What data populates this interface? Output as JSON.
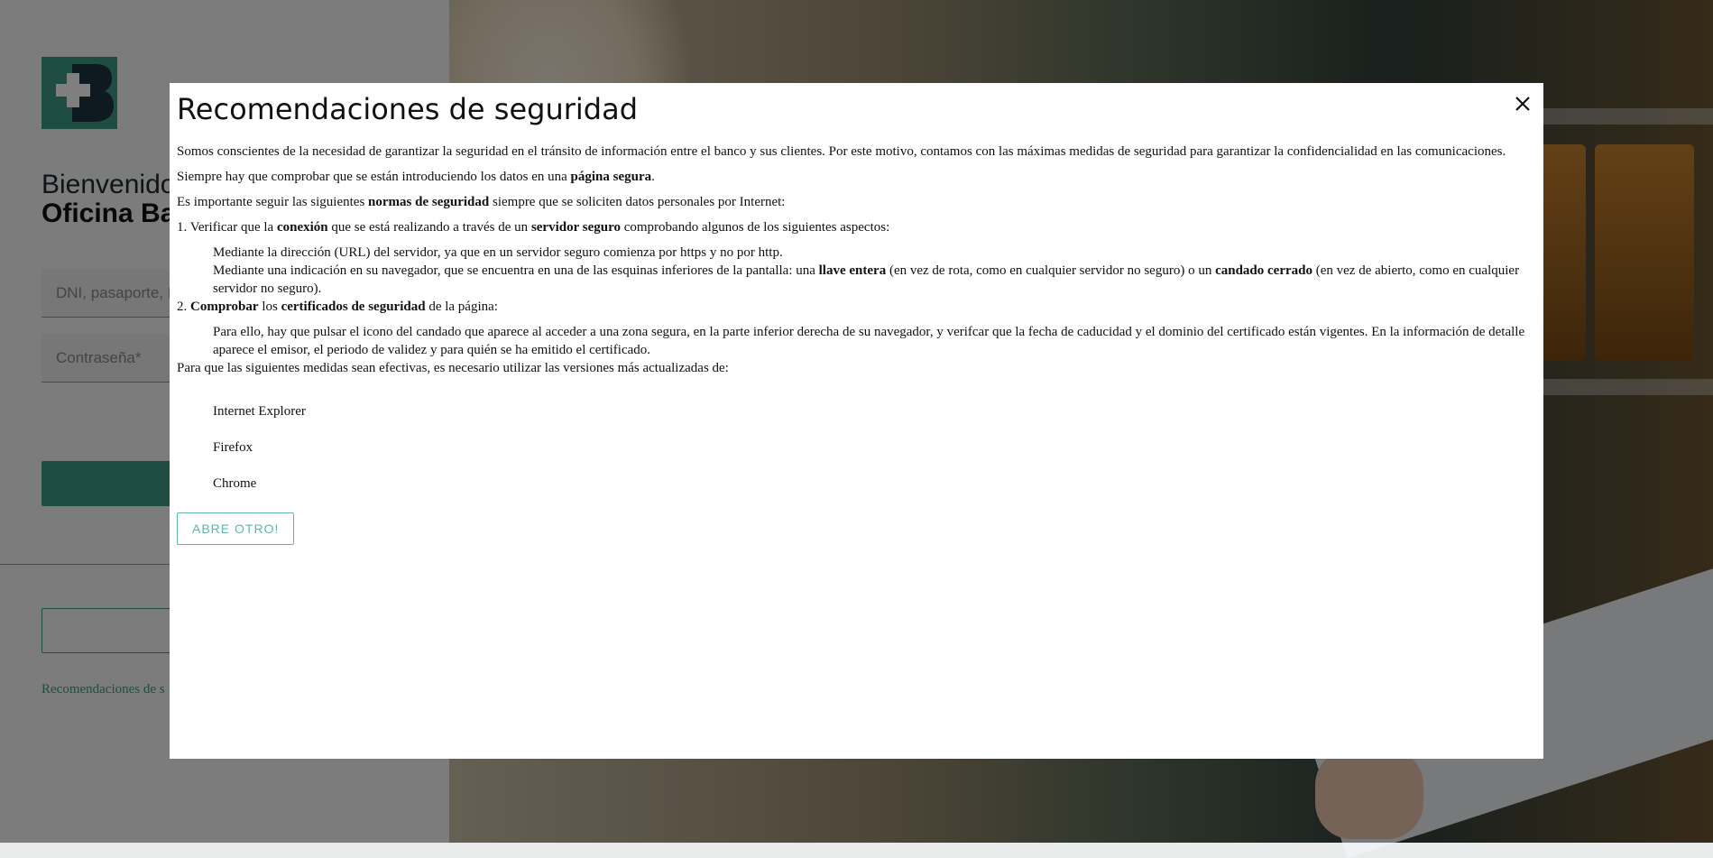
{
  "login": {
    "welcome": "Bienvenido",
    "welcome_strong": "Oficina Ba",
    "id_placeholder": "DNI, pasaporte, N",
    "password_placeholder": "Contraseña*",
    "recommendations_link": "Recomendaciones de s"
  },
  "modal": {
    "title": "Recomendaciones de seguridad",
    "p1": "Somos conscientes de la necesidad de garantizar la seguridad en el tránsito de información entre el banco y sus clientes. Por este motivo, contamos con las máximas medidas de seguridad para garantizar la confidencialidad en las comunicaciones.",
    "p2_a": "Siempre hay que comprobar que se están introduciendo los datos en una ",
    "p2_b": "página segura",
    "p2_c": ".",
    "p3_a": "Es importante seguir las siguientes ",
    "p3_b": "normas de seguridad",
    "p3_c": " siempre que se soliciten datos personales por Internet:",
    "item1_a": "1. Verificar que la ",
    "item1_b": "conexión",
    "item1_c": " que se está realizando a través de un ",
    "item1_d": "servidor seguro",
    "item1_e": " comprobando algunos de los siguientes aspectos:",
    "item1_sub1": "Mediante la dirección (URL) del servidor, ya que en un servidor seguro comienza por https y no por http.",
    "item1_sub2_a": "Mediante una indicación en su navegador, que se encuentra en una de las esquinas inferiores de la pantalla: una ",
    "item1_sub2_b": "llave entera",
    "item1_sub2_c": " (en vez de rota, como en cualquier servidor no seguro) o un ",
    "item1_sub2_d": "candado cerrado",
    "item1_sub2_e": " (en vez de abierto, como en cualquier servidor no seguro).",
    "item2_a": "2. ",
    "item2_b": "Comprobar",
    "item2_c": " los ",
    "item2_d": "certificados de seguridad",
    "item2_e": " de la página:",
    "item2_sub1": "Para ello, hay que pulsar el icono del candado que aparece al acceder a una zona segura, en la parte inferior derecha de su navegador, y verifcar que la fecha de caducidad y el dominio del certificado están vigentes. En la información de detalle aparece el emisor, el periodo de validez y para quién se ha emitido el certificado.",
    "p4": "Para que las siguientes medidas sean efectivas, es necesario utilizar las versiones más actualizadas de:",
    "browsers": [
      "Internet Explorer",
      "Firefox",
      "Chrome"
    ],
    "button_label": "ABRE OTRO!",
    "close_icon": "close-icon"
  },
  "colors": {
    "accent": "#3e9a88",
    "button_border": "#5fb7a7"
  }
}
